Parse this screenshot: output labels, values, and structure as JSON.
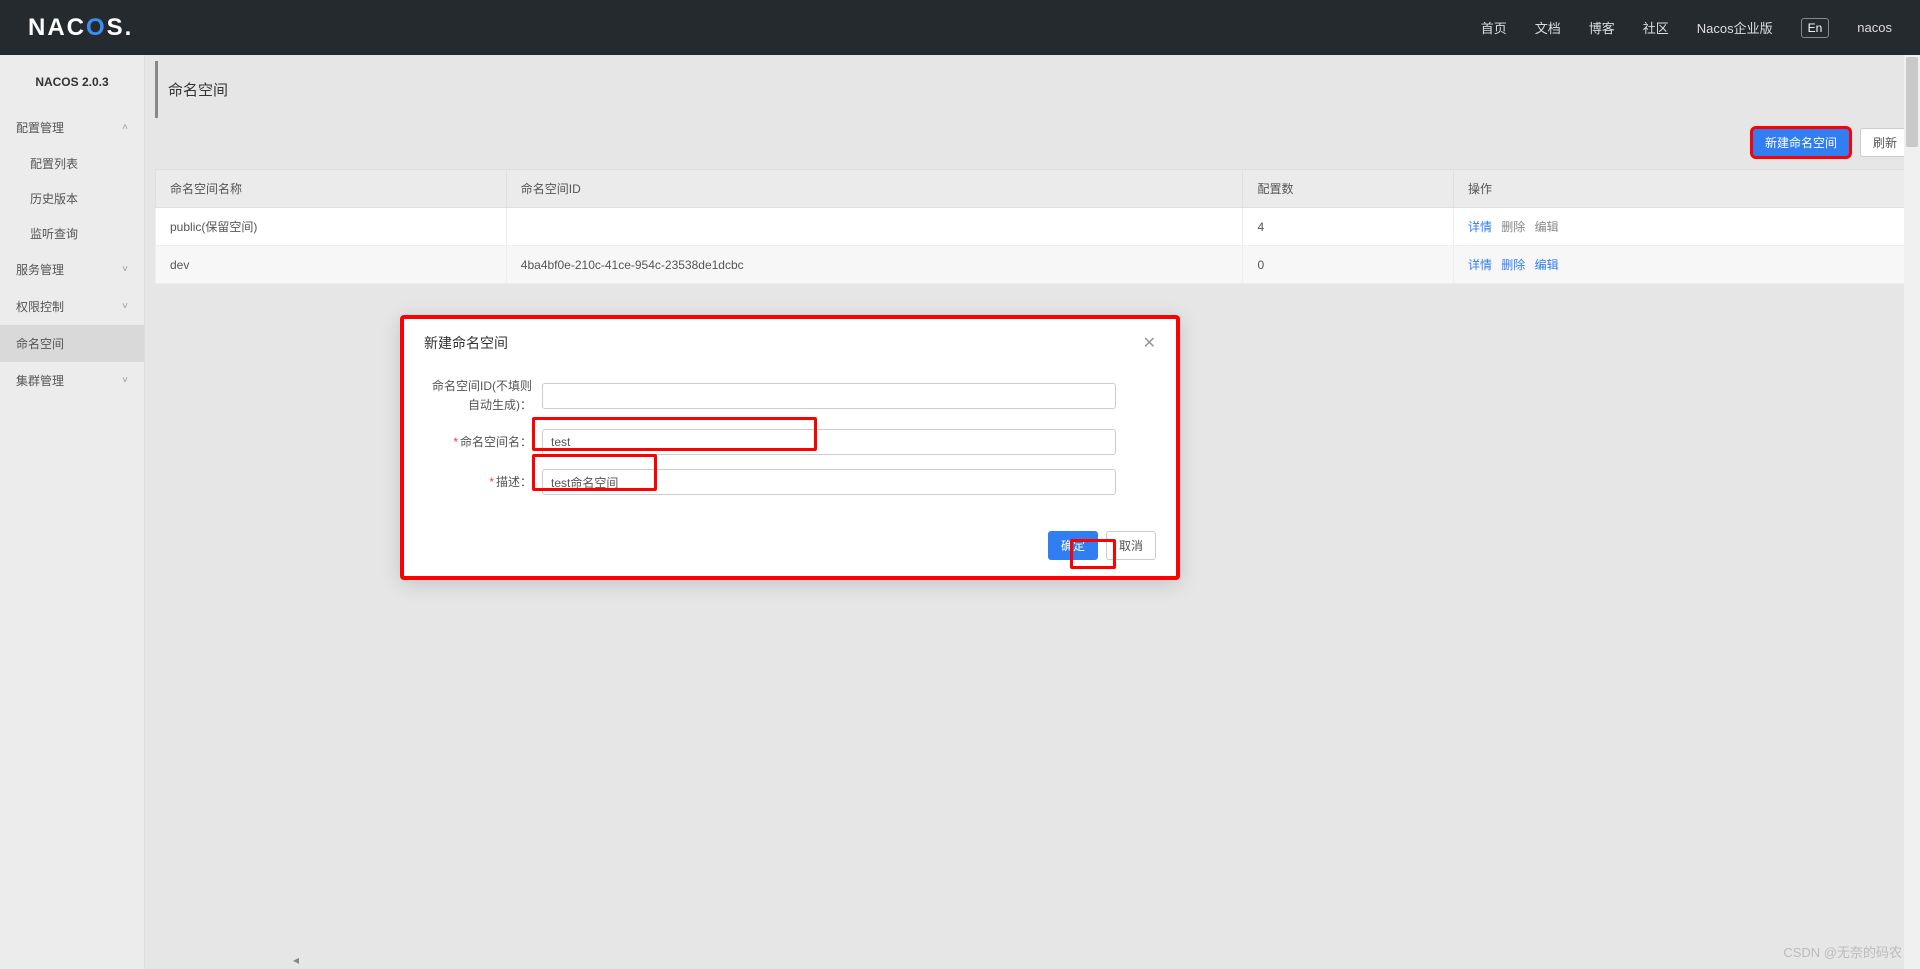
{
  "header": {
    "logo_pre": "NAC",
    "logo_mid": "O",
    "logo_post": "S.",
    "nav": {
      "home": "首页",
      "docs": "文档",
      "blog": "博客",
      "community": "社区",
      "enterprise": "Nacos企业版",
      "lang": "En",
      "user": "nacos"
    }
  },
  "sidebar": {
    "version": "NACOS 2.0.3",
    "config_mgmt": "配置管理",
    "config_list": "配置列表",
    "history": "历史版本",
    "listen_query": "监听查询",
    "service_mgmt": "服务管理",
    "perm_ctrl": "权限控制",
    "namespace": "命名空间",
    "cluster_mgmt": "集群管理"
  },
  "page": {
    "title": "命名空间",
    "btn_new": "新建命名空间",
    "btn_refresh": "刷新"
  },
  "table": {
    "headers": {
      "name": "命名空间名称",
      "id": "命名空间ID",
      "config_count": "配置数",
      "ops": "操作"
    },
    "rows": [
      {
        "name": "public(保留空间)",
        "id": "",
        "count": "4",
        "detail": "详情",
        "delete": "删除",
        "edit": "编辑",
        "muted": true
      },
      {
        "name": "dev",
        "id": "4ba4bf0e-210c-41ce-954c-23538de1dcbc",
        "count": "0",
        "detail": "详情",
        "delete": "删除",
        "edit": "编辑",
        "muted": false
      }
    ]
  },
  "modal": {
    "title": "新建命名空间",
    "label_id": "命名空间ID(不填则自动生成)：",
    "label_name": "命名空间名：",
    "label_desc": "描述：",
    "val_id": "",
    "val_name": "test",
    "val_desc": "test命名空间",
    "btn_ok": "确定",
    "btn_cancel": "取消"
  },
  "watermark": "CSDN @无奈的码农"
}
